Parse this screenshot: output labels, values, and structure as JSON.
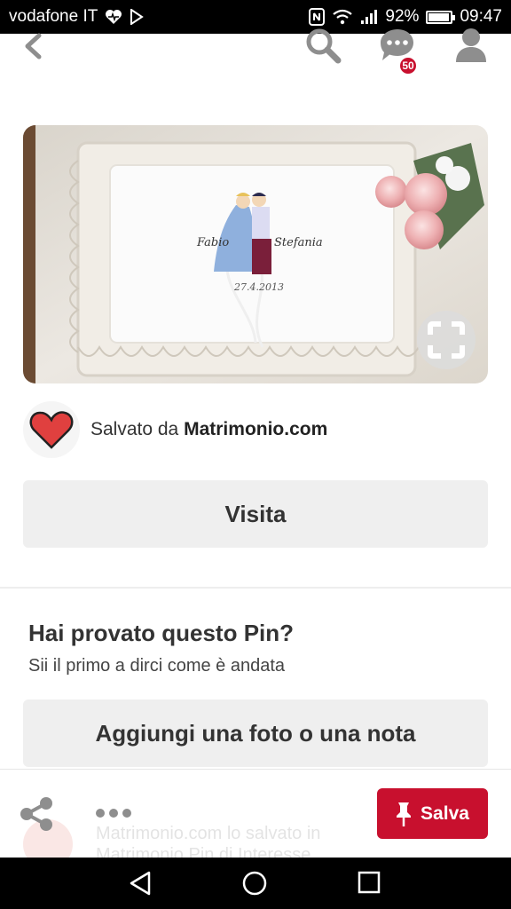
{
  "status_bar": {
    "carrier": "vodafone IT",
    "battery": "92%",
    "battery_level": 0.92,
    "time": "09:47"
  },
  "header": {
    "messages_badge": "50",
    "icons": [
      "back-arrow-icon",
      "search-icon",
      "chat-icon",
      "profile-icon"
    ]
  },
  "pin": {
    "image_handwriting": [
      "Fabio",
      "Stefania",
      "27.4.2013"
    ],
    "saved_prefix": "Salvato da",
    "saved_source": "Matrimonio.com",
    "visit_label": "Visita"
  },
  "tried": {
    "title": "Hai provato questo Pin?",
    "subtitle": "Sii il primo a dirci come è andata",
    "add_label": "Aggiungi una foto o una nota"
  },
  "action_bar": {
    "save_label": "Salva",
    "ghost_line1": "Matrimonio.com lo salvato in",
    "ghost_line2": "Matrimonio Pin di Interesse"
  },
  "colors": {
    "accent": "#c8102e",
    "button_grey": "#efefef",
    "icon_grey": "#8e8e8e"
  }
}
